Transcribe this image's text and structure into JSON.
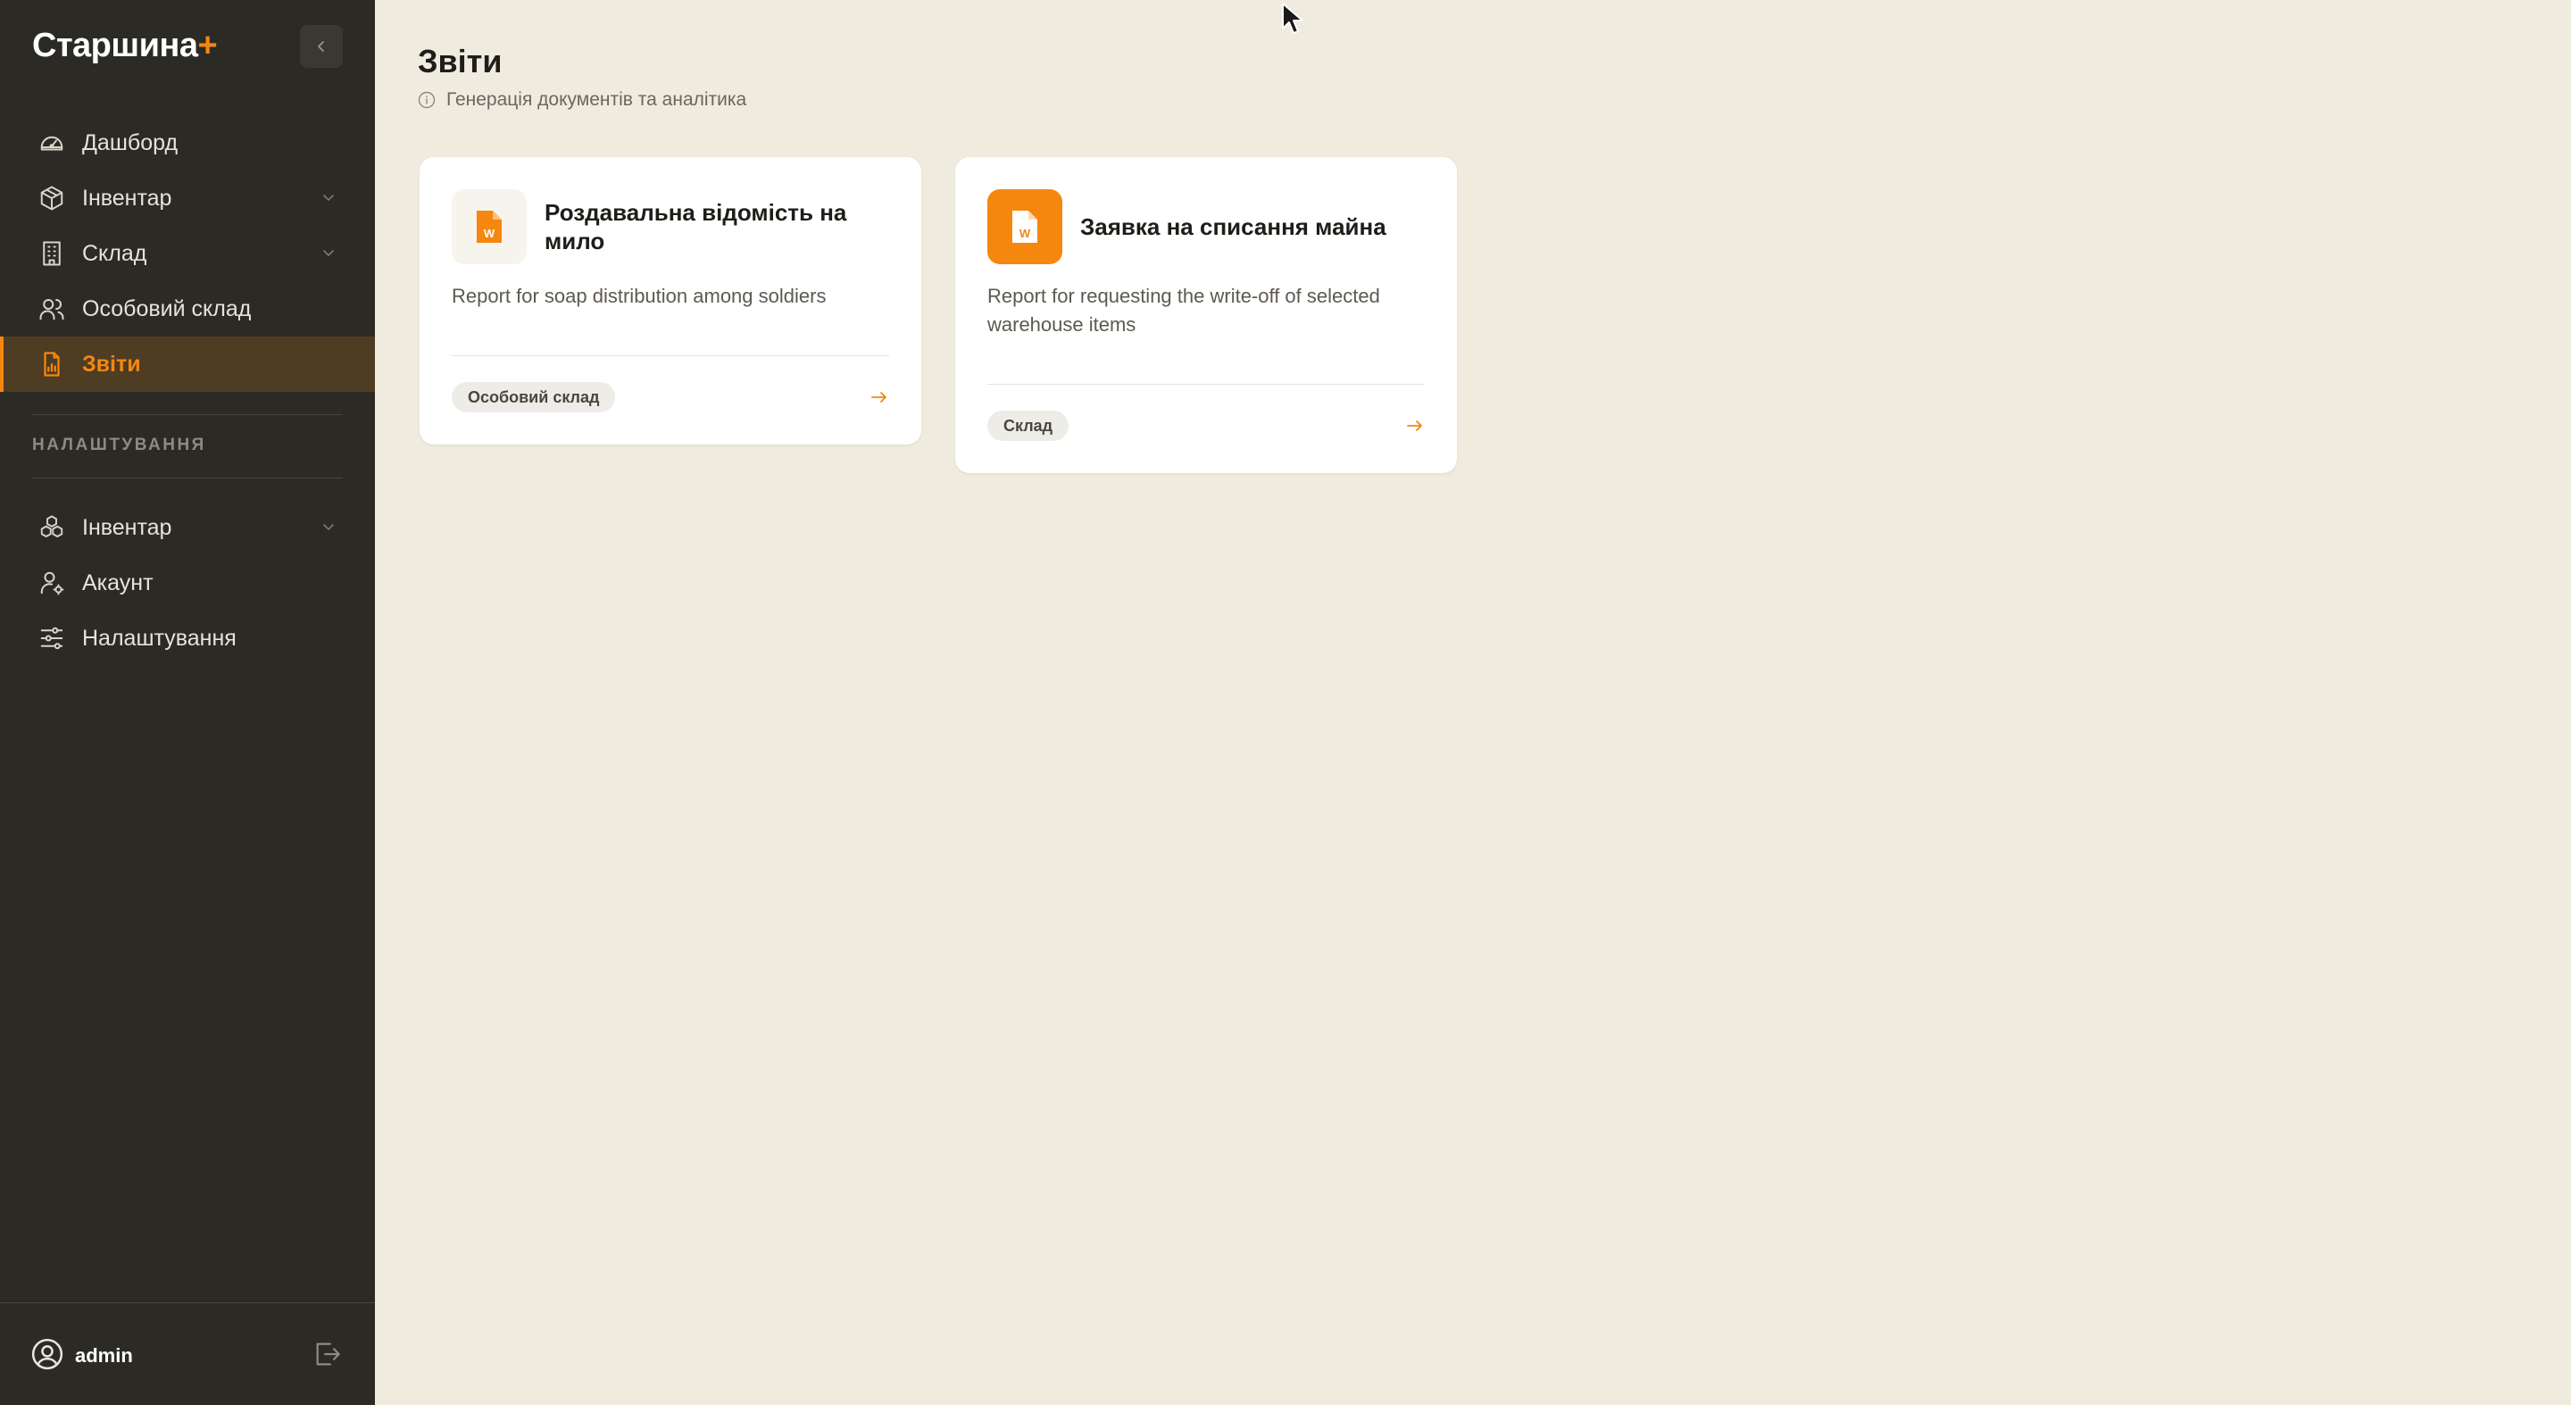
{
  "sidebar": {
    "brand": {
      "name": "Старшина",
      "plus": "+"
    },
    "nav": [
      {
        "label": "Дашборд",
        "icon": "gauge-icon"
      },
      {
        "label": "Інвентар",
        "icon": "box-icon",
        "expandable": true
      },
      {
        "label": "Склад",
        "icon": "building-icon",
        "expandable": true
      },
      {
        "label": "Особовий склад",
        "icon": "users-icon"
      },
      {
        "label": "Звіти",
        "icon": "report-file-icon",
        "active": true
      }
    ],
    "settings_label": "НАЛАШТУВАННЯ",
    "settings_nav": [
      {
        "label": "Інвентар",
        "icon": "boxes-icon",
        "expandable": true
      },
      {
        "label": "Акаунт",
        "icon": "user-gear-icon"
      },
      {
        "label": "Налаштування",
        "icon": "sliders-icon"
      }
    ],
    "user": {
      "name": "admin"
    }
  },
  "main": {
    "title": "Звіти",
    "subtitle": "Генерація документів та аналітика",
    "cards": [
      {
        "title": "Роздавальна відомість на мило",
        "description": "Report for soap distribution among soldiers",
        "tag": "Особовий склад",
        "icon": "word-document-icon"
      },
      {
        "title": "Заявка на списання майна",
        "description": "Report for requesting the write-off of selected warehouse items",
        "tag": "Склад",
        "icon": "word-document-icon"
      }
    ]
  },
  "colors": {
    "accent": "#f5870f",
    "sidebar_bg": "#2c2a25",
    "page_bg": "#efebdf",
    "active_bg": "#4e3c23"
  }
}
